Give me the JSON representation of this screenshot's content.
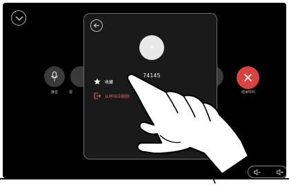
{
  "call_controls": {
    "mute_label": "静音",
    "video_label": "视",
    "end_call_label": "结束呼叫"
  },
  "contact_panel": {
    "avatar_text": "#",
    "number": "74145",
    "menu": [
      {
        "label": "收藏",
        "icon": "star-icon",
        "color": "#ffffff"
      },
      {
        "label": "从呼叫中删除",
        "icon": "remove-from-call-icon",
        "color": "#e8605b"
      }
    ]
  },
  "colors": {
    "background": "#000000",
    "panel": "#1a1a1a",
    "end_call": "#d9433f",
    "danger_text": "#e8605b"
  },
  "icons": [
    "chevron-down-icon",
    "back-arrow-icon",
    "microphone-icon",
    "close-icon",
    "volume-down-icon",
    "volume-up-icon"
  ]
}
